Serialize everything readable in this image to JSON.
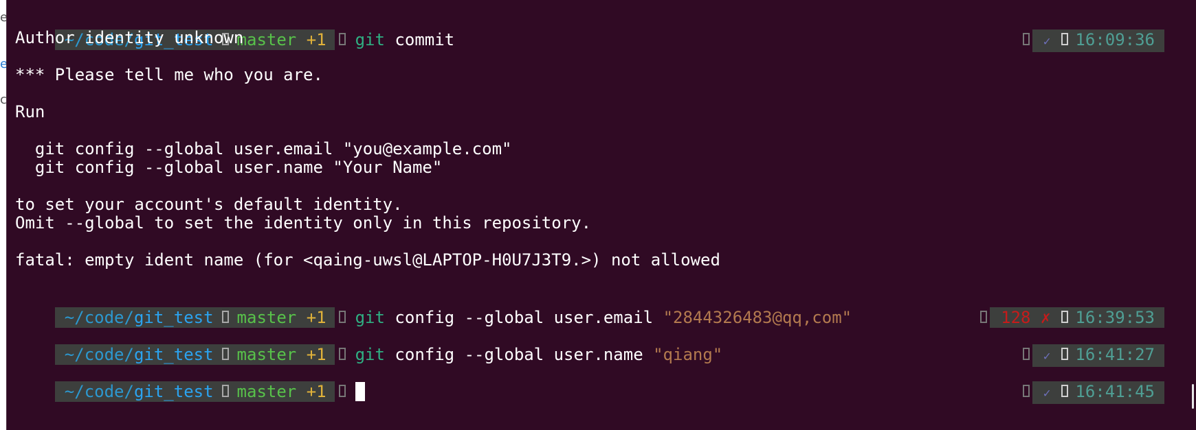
{
  "desktop": {
    "edge_chars": [
      "e",
      "e",
      "c"
    ]
  },
  "terminal": {
    "colors": {
      "background": "#300a24",
      "prompt_bg": "#3d3f3d",
      "path": "#2ba3f0",
      "branch": "#58c24a",
      "dirty": "#e0b23a",
      "git_cmd": "#2fb083",
      "string": "#b37a4f",
      "time": "#4f9e94",
      "error": "#c61b1b"
    },
    "prompt": {
      "path_prefix": "~/code/",
      "path_dir": "git_test",
      "branch": "master",
      "dirty": "+1"
    },
    "commands": [
      {
        "git": "git",
        "args": "commit",
        "string": "",
        "status": "✓",
        "exit_code": "",
        "time": "16:09:36"
      },
      {
        "git": "git",
        "args": "config --global user.email ",
        "string": "\"2844326483@qq,com\"",
        "status": "✗",
        "exit_code": "128",
        "time": "16:39:53"
      },
      {
        "git": "git",
        "args": "config --global user.name ",
        "string": "\"qiang\"",
        "status": "✓",
        "exit_code": "",
        "time": "16:41:27"
      },
      {
        "git": "",
        "args": "",
        "string": "",
        "status": "✓",
        "exit_code": "",
        "time": "16:41:45"
      }
    ],
    "output": {
      "l1": "Author identity unknown",
      "l2": "*** Please tell me who you are.",
      "l3": "Run",
      "l4": "  git config --global user.email \"you@example.com\"",
      "l5": "  git config --global user.name \"Your Name\"",
      "l6": "to set your account's default identity.",
      "l7": "Omit --global to set the identity only in this repository.",
      "l8": "fatal: empty ident name (for <qaing-uwsl@LAPTOP-H0U7J3T9.>) not allowed"
    }
  }
}
